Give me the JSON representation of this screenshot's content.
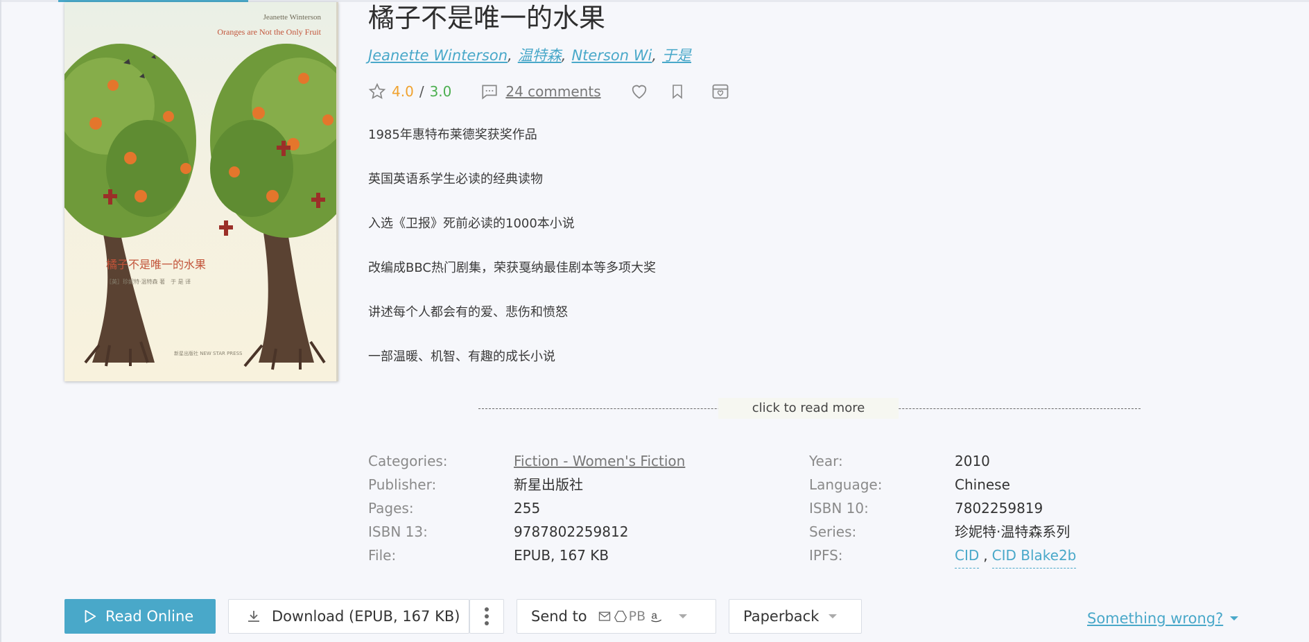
{
  "book": {
    "title": "橘子不是唯一的水果",
    "authors": [
      "Jeanette Winterson",
      "温特森",
      "Nterson Wi",
      "于是"
    ],
    "rating_a": "4.0",
    "rating_sep": "/",
    "rating_b": "3.0",
    "comments": "24 comments"
  },
  "cover": {
    "author": "Jeanette Winterson",
    "title_en": "Oranges are Not the Only Fruit",
    "title_zh": "橘子不是唯一的水果",
    "subtitle": "［英］珍妮特·温特森 著　于 是 译",
    "publisher": "新星出版社 NEW STAR PRESS"
  },
  "description": [
    "1985年惠特布莱德奖获奖作品",
    "英国英语系学生必读的经典读物",
    "入选《卫报》死前必读的1000本小说",
    "改编成BBC热门剧集，荣获戛纳最佳剧本等多项大奖",
    "讲述每个人都会有的爱、悲伤和愤怒",
    "一部温暖、机智、有趣的成长小说",
    "……"
  ],
  "read_more": "click to read more",
  "properties": {
    "left": [
      {
        "key": "Categories:",
        "value": "Fiction - Women's Fiction"
      },
      {
        "key": "Publisher:",
        "value": "新星出版社"
      },
      {
        "key": "Pages:",
        "value": "255"
      },
      {
        "key": "ISBN 13:",
        "value": "9787802259812"
      },
      {
        "key": "File:",
        "value": "EPUB, 167 KB"
      }
    ],
    "right": [
      {
        "key": "Year:",
        "value": "2010"
      },
      {
        "key": "Language:",
        "value": "Chinese"
      },
      {
        "key": "ISBN 10:",
        "value": "7802259819"
      },
      {
        "key": "Series:",
        "value": "珍妮特·温特森系列"
      },
      {
        "key": "IPFS:",
        "cid": "CID",
        "comma": ",",
        "cid2": "CID Blake2b"
      }
    ]
  },
  "actions": {
    "read_online": "Read Online",
    "download": "Download (EPUB, 167 KB)",
    "send_to": "Send to",
    "send_pb": "PB",
    "paperback": "Paperback",
    "something_wrong": "Something wrong?"
  },
  "colors": {
    "accent": "#49a8c9",
    "rating_a": "#f0a22e",
    "rating_b": "#4caf50"
  },
  "icons": [
    "play-icon",
    "download-icon",
    "more-vertical-icon",
    "mail-icon",
    "drive-icon",
    "amazon-icon",
    "star-icon",
    "comment-icon",
    "heart-icon",
    "bookmark-icon",
    "archive-icon"
  ]
}
